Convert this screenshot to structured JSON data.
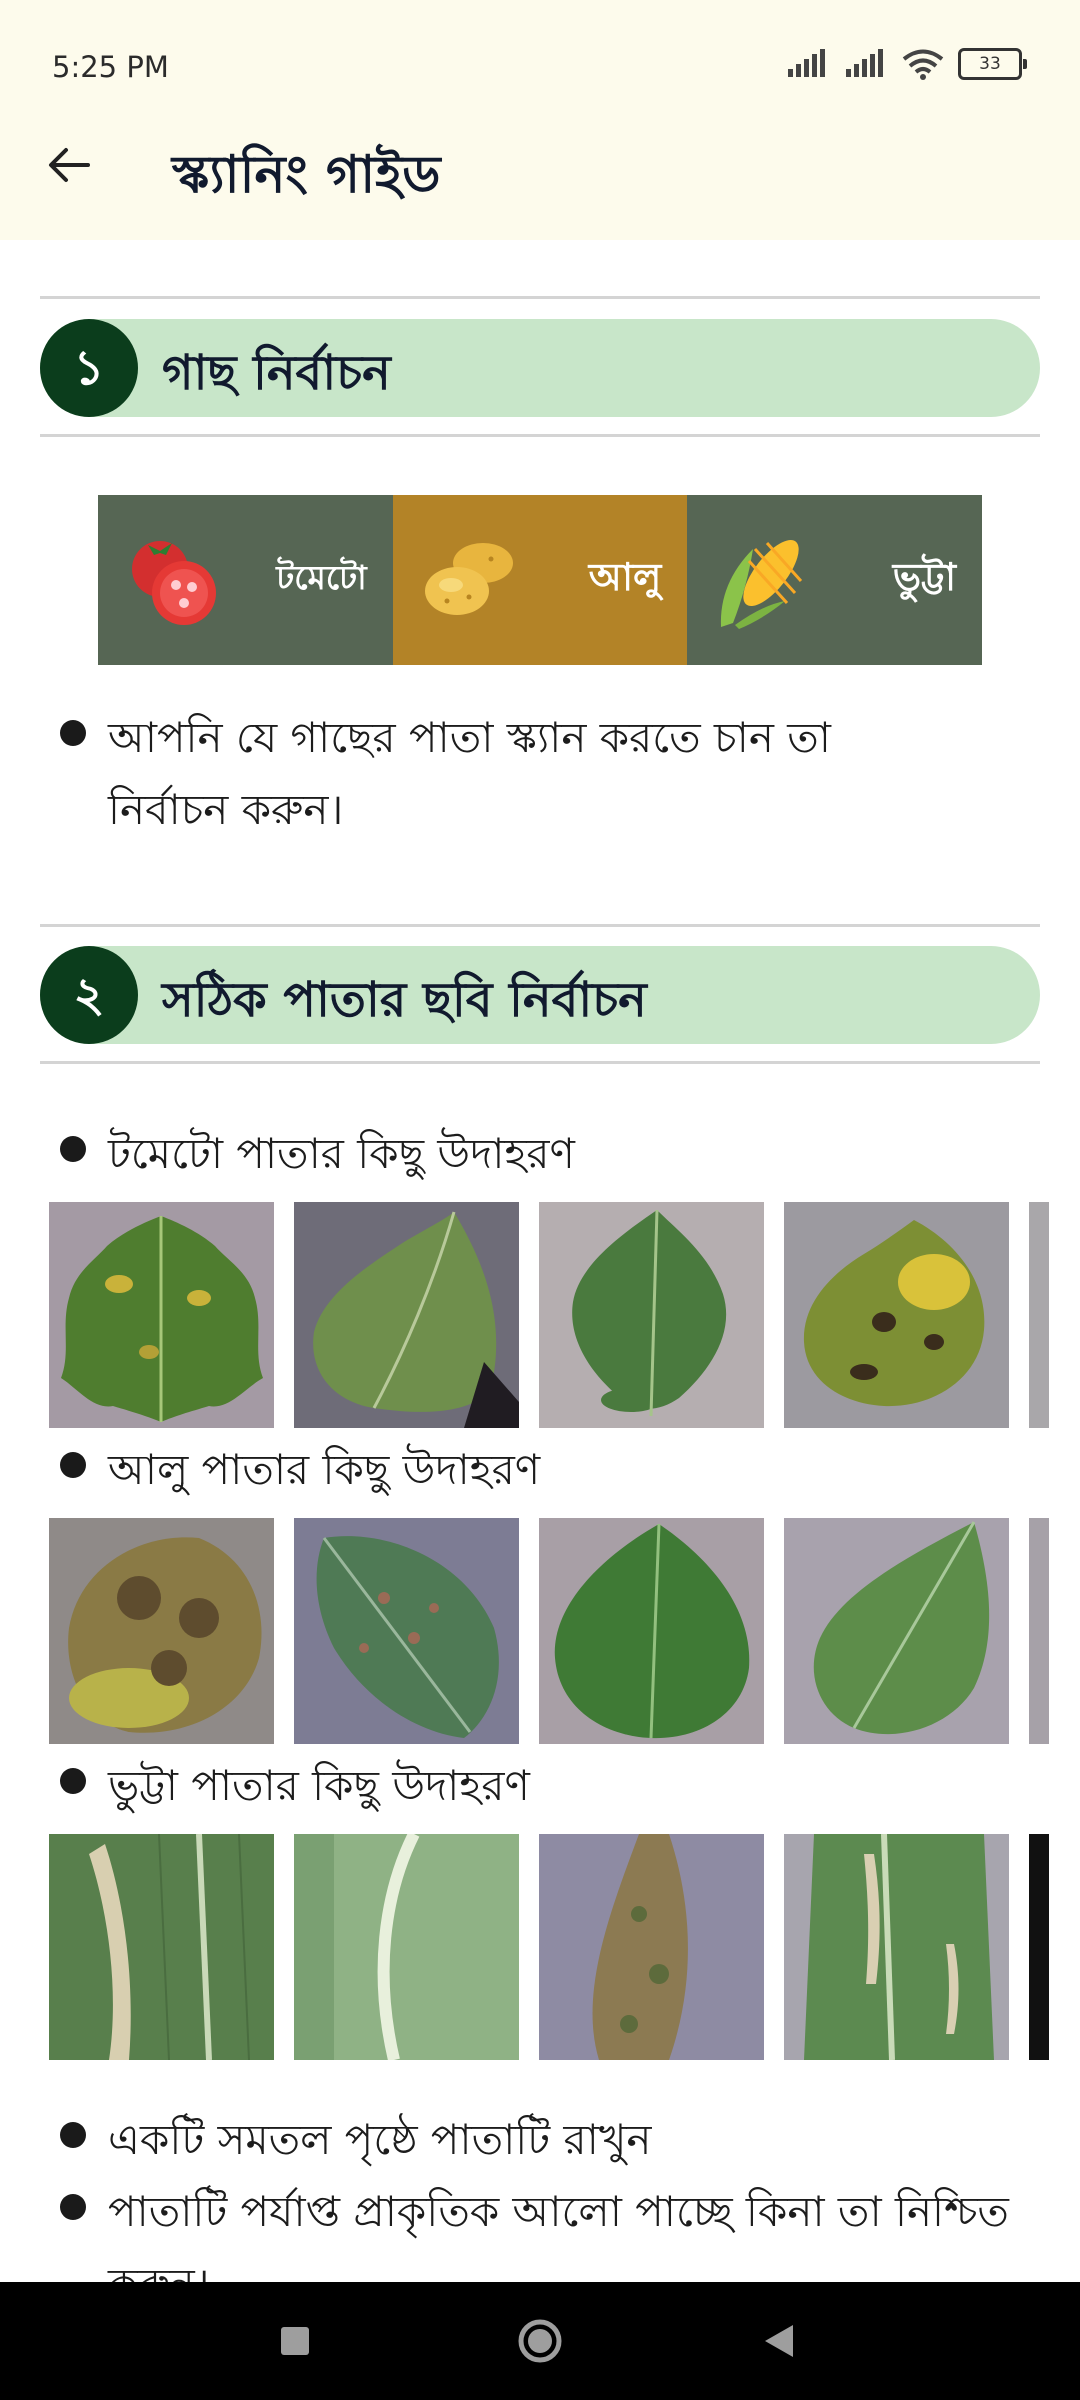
{
  "status": {
    "time": "5:25 PM",
    "battery": "33"
  },
  "header": {
    "title": "স্ক্যানিং গাইড"
  },
  "step1": {
    "number": "১",
    "title": "গাছ নির্বাচন",
    "crops": [
      {
        "label": "টমেটো",
        "icon": "tomato-icon",
        "selected": false
      },
      {
        "label": "আলু",
        "icon": "potato-icon",
        "selected": true
      },
      {
        "label": "ভুট্টা",
        "icon": "corn-icon",
        "selected": false
      }
    ],
    "instruction": "আপনি যে গাছের পাতা স্ক্যান করতে চান তা নির্বাচন করুন।"
  },
  "step2": {
    "number": "২",
    "title": "সঠিক পাতার ছবি নির্বাচন",
    "examples": [
      {
        "label": "টমেটো পাতার কিছু উদাহরণ"
      },
      {
        "label": "আলু পাতার কিছু উদাহরণ"
      },
      {
        "label": "ভুট্টা পাতার কিছু উদাহরণ"
      }
    ],
    "tips": [
      "একটি সমতল পৃষ্ঠে পাতাটি রাখুন",
      "পাতাটি পর্যাপ্ত প্রাকৃতিক আলো পাচ্ছে কিনা তা নিশ্চিত করুন।"
    ]
  },
  "colors": {
    "selected_crop": "#b38327",
    "crop_tile": "#566654",
    "step_pill": "#c8e6c9",
    "step_badge": "#0b3d1c",
    "header_bg": "#fdfbec"
  }
}
